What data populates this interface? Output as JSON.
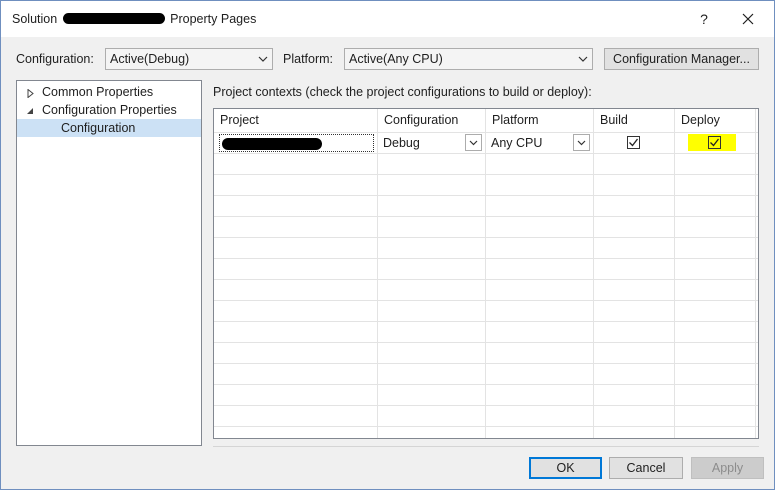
{
  "window": {
    "title_prefix": "Solution",
    "title_suffix": "Property Pages",
    "help_label": "?",
    "close_label": "✕"
  },
  "toolbar": {
    "configuration_label": "Configuration:",
    "configuration_value": "Active(Debug)",
    "platform_label": "Platform:",
    "platform_value": "Active(Any CPU)",
    "config_manager_label": "Configuration Manager..."
  },
  "tree": {
    "items": [
      {
        "label": "Common Properties",
        "expanded": false
      },
      {
        "label": "Configuration Properties",
        "expanded": true
      },
      {
        "label": "Configuration",
        "selected": true
      }
    ]
  },
  "grid": {
    "caption": "Project contexts (check the project configurations to build or deploy):",
    "columns": [
      "Project",
      "Configuration",
      "Platform",
      "Build",
      "Deploy"
    ],
    "rows": [
      {
        "project": "",
        "configuration": "Debug",
        "platform": "Any CPU",
        "build": true,
        "deploy": true
      }
    ]
  },
  "buttons": {
    "ok": "OK",
    "cancel": "Cancel",
    "apply": "Apply"
  },
  "colors": {
    "accent": "#0078d7",
    "selection": "#cce1f5",
    "highlight": "#ffff00"
  }
}
